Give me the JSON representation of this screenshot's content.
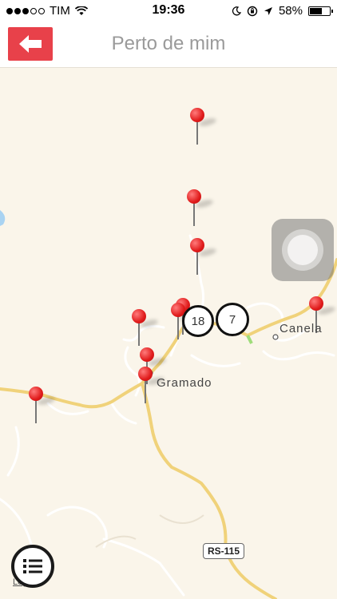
{
  "status_bar": {
    "carrier": "TIM",
    "time": "19:36",
    "battery_percent": "58%",
    "battery_level": 0.58
  },
  "navbar": {
    "title": "Perto de mim",
    "back_icon": "arrow-left-icon",
    "accent_color": "#e8414a"
  },
  "map": {
    "places": {
      "gramado": "Gramado",
      "canela": "Canela"
    },
    "road_shield": "RS-115",
    "legal": "Legal",
    "clusters": [
      {
        "count": "18"
      },
      {
        "count": "7"
      }
    ]
  },
  "list_button_icon": "list-icon"
}
